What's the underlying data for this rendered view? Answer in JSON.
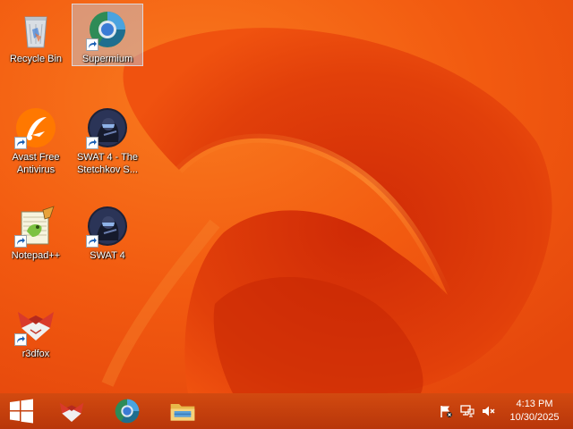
{
  "desktop": {
    "icons": [
      {
        "label": "Recycle Bin",
        "icon": "recycle-bin-icon"
      },
      {
        "label": "Supermium",
        "icon": "supermium-icon",
        "selected": true
      },
      {
        "label": "Avast Free Antivirus",
        "icon": "avast-icon"
      },
      {
        "label": "SWAT 4 - The Stetchkov S...",
        "icon": "swat4-icon"
      },
      {
        "label": "Notepad++",
        "icon": "notepadplusplus-icon"
      },
      {
        "label": "SWAT 4",
        "icon": "swat4-icon"
      },
      {
        "label": "r3dfox",
        "icon": "r3dfox-icon"
      }
    ]
  },
  "taskbar": {
    "start_icon": "windows-logo-icon",
    "pinned": [
      {
        "name": "r3dfox",
        "icon": "r3dfox-icon"
      },
      {
        "name": "Supermium",
        "icon": "supermium-icon"
      },
      {
        "name": "File Explorer",
        "icon": "folder-icon"
      }
    ],
    "tray": [
      {
        "name": "action-center",
        "icon": "flag-icon"
      },
      {
        "name": "network",
        "icon": "network-icon"
      },
      {
        "name": "volume",
        "icon": "speaker-muted-icon"
      }
    ],
    "clock": {
      "time": "4:13 PM",
      "date": "10/30/2025"
    }
  },
  "colors": {
    "wallpaper_base": "#f25a10",
    "wallpaper_dark": "#d32e08",
    "taskbar": "#c93e0c",
    "selection": "#bed2eb"
  }
}
